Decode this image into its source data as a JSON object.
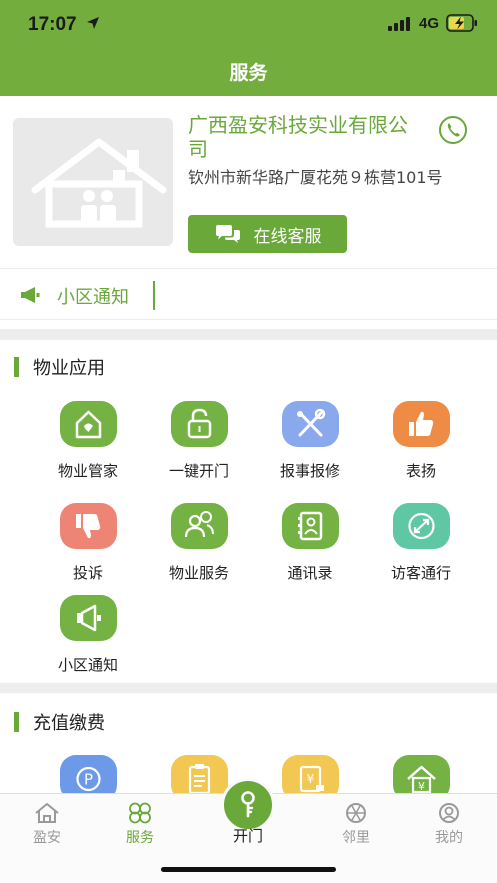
{
  "status_bar": {
    "time": "17:07",
    "network": "4G"
  },
  "header": {
    "title": "服务"
  },
  "company": {
    "name": "广西盈安科技实业有限公司",
    "address": "钦州市新华路广厦花苑９栋营101号",
    "service_button": "在线客服"
  },
  "notice": {
    "label": "小区通知"
  },
  "property_apps": {
    "title": "物业应用",
    "items": [
      {
        "label": "物业管家",
        "icon": "house-heart-icon",
        "color": "#74b244"
      },
      {
        "label": "一键开门",
        "icon": "unlock-icon",
        "color": "#74b244"
      },
      {
        "label": "报事报修",
        "icon": "tools-icon",
        "color": "#8aa8ec"
      },
      {
        "label": "表扬",
        "icon": "thumbs-up-icon",
        "color": "#ee8b45"
      },
      {
        "label": "投诉",
        "icon": "thumbs-down-icon",
        "color": "#ee8574"
      },
      {
        "label": "物业服务",
        "icon": "people-icon",
        "color": "#74b244"
      },
      {
        "label": "通讯录",
        "icon": "contacts-icon",
        "color": "#74b244"
      },
      {
        "label": "访客通行",
        "icon": "visitor-icon",
        "color": "#5fc7a3"
      },
      {
        "label": "小区通知",
        "icon": "megaphone-icon",
        "color": "#74b244"
      }
    ]
  },
  "payment": {
    "title": "充值缴费",
    "items": [
      {
        "icon": "parking-icon",
        "color": "#6c9ae9"
      },
      {
        "icon": "bill-icon",
        "color": "#f2c752"
      },
      {
        "icon": "fee-icon",
        "color": "#f2c752"
      },
      {
        "icon": "house-yuan-icon",
        "color": "#74b244"
      }
    ]
  },
  "tabbar": {
    "tabs": [
      {
        "label": "盈安",
        "icon": "home-icon"
      },
      {
        "label": "服务",
        "icon": "clover-icon",
        "active": true
      },
      {
        "label": "开门",
        "icon": "key-icon"
      },
      {
        "label": "邻里",
        "icon": "aperture-icon"
      },
      {
        "label": "我的",
        "icon": "profile-icon"
      }
    ]
  }
}
